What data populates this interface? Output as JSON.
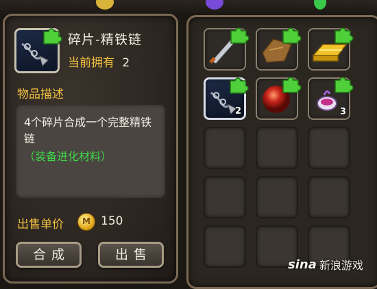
{
  "item": {
    "name": "碎片-精铁链",
    "owned_label": "当前拥有",
    "owned_count": "2"
  },
  "description": {
    "title": "物品描述",
    "text": "4个碎片合成一个完整精铁链",
    "subtext": "（装备进化材料）"
  },
  "price": {
    "label": "出售单价",
    "coin_symbol": "M",
    "value": "150"
  },
  "buttons": {
    "combine": "合成",
    "sell": "出售"
  },
  "inventory": [
    {
      "icon": "dagger-fragment-icon",
      "qty": ""
    },
    {
      "icon": "leather-scrap-fragment-icon",
      "qty": ""
    },
    {
      "icon": "gold-bar-fragment-icon",
      "qty": ""
    },
    {
      "icon": "iron-chain-fragment-icon",
      "qty": "2",
      "selected": true
    },
    {
      "icon": "red-orb-fragment-icon",
      "qty": ""
    },
    {
      "icon": "purple-potion-fragment-icon",
      "qty": "3"
    }
  ],
  "watermark": {
    "logo": "sina",
    "text": "新浪游戏"
  },
  "colors": {
    "accent_gold": "#f0c040",
    "green_text": "#3ed84a",
    "puzzle_green": "#4fcf3a"
  }
}
